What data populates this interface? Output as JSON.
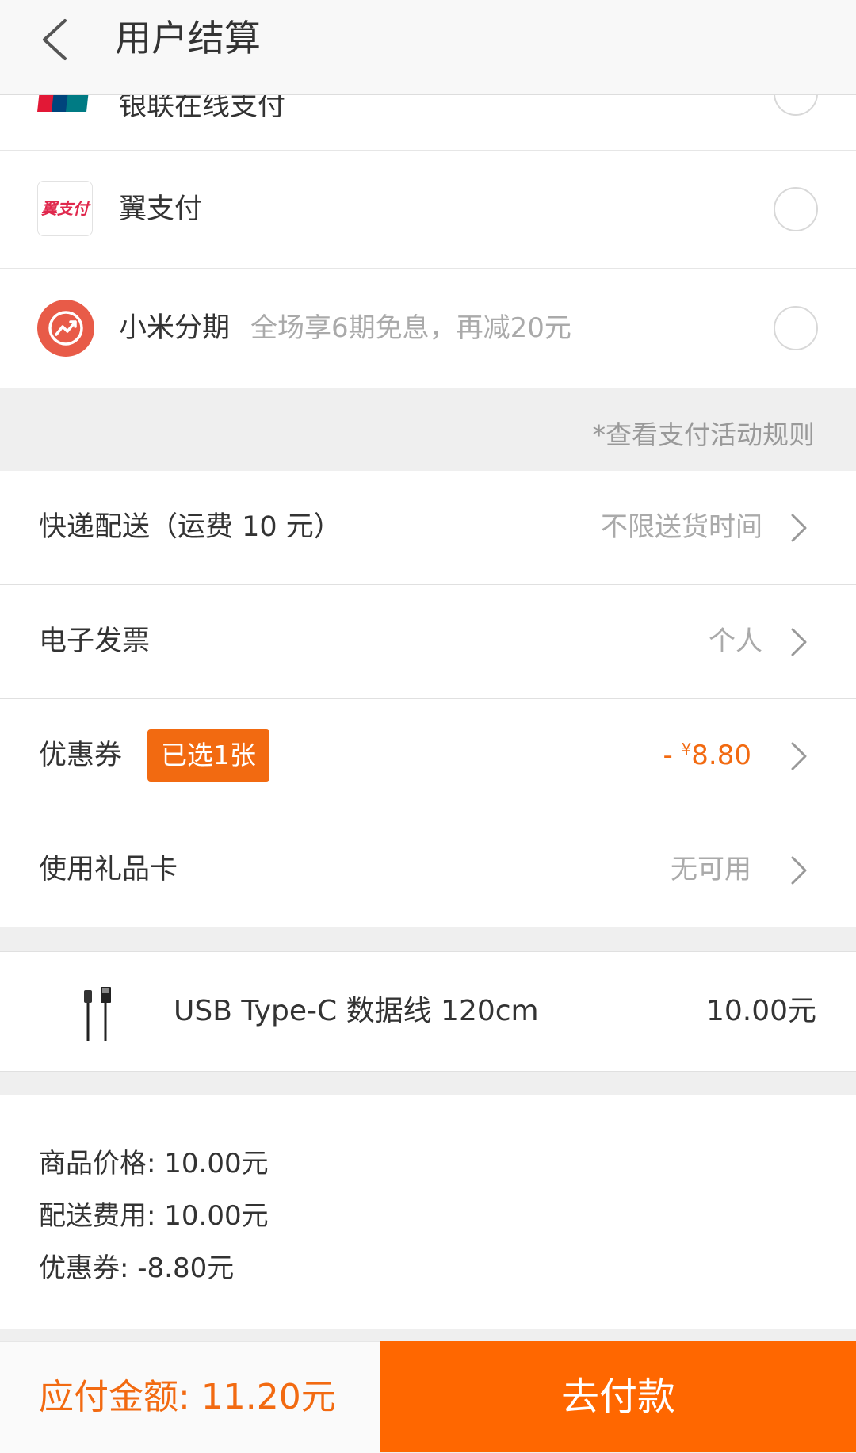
{
  "header": {
    "title": "用户结算"
  },
  "payments": [
    {
      "name": "银联在线支付",
      "logo_text": "银联"
    },
    {
      "name": "翼支付",
      "logo_text": "翼支付"
    },
    {
      "name": "小米分期",
      "sub": "全场享6期免息，再减20元"
    }
  ],
  "rules_link": "*查看支付活动规则",
  "options": {
    "delivery": {
      "label": "快递配送（运费 10 元）",
      "value": "不限送货时间"
    },
    "invoice": {
      "label": "电子发票",
      "value": "个人"
    },
    "coupon": {
      "label": "优惠券",
      "badge": "已选1张",
      "value_prefix": "- ",
      "currency": "¥",
      "value": "8.80"
    },
    "giftcard": {
      "label": "使用礼品卡",
      "value": "无可用"
    }
  },
  "product": {
    "name": "USB Type-C 数据线 120cm",
    "price": "10.00元"
  },
  "summary": {
    "goods_price": "商品价格:   10.00元",
    "shipping": "配送费用:   10.00元",
    "coupon": "优惠券:   -8.80元"
  },
  "bottom": {
    "total": "应付金额: 11.20元",
    "pay_button": "去付款"
  },
  "colors": {
    "accent": "#ff6700",
    "badge": "#f26a11",
    "xiaomi_fenqi": "#e85b48"
  }
}
